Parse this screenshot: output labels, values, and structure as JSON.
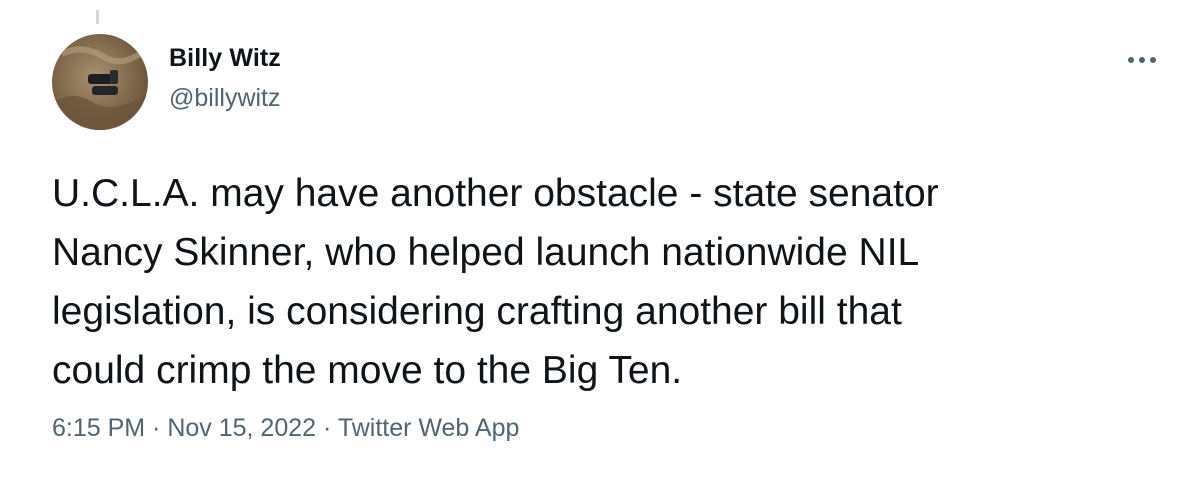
{
  "tweet": {
    "author": {
      "display_name": "Billy Witz",
      "handle": "@billywitz",
      "avatar": "profile-photo"
    },
    "more_icon": "more-horizontal-icon",
    "text": "U.C.L.A. may have another obstacle - state senator\nNancy Skinner, who helped launch nationwide NIL\nlegislation, is considering crafting another bill that\ncould crimp the move to the Big Ten.",
    "meta": {
      "time": "6:15 PM",
      "separator": " · ",
      "date": "Nov 15, 2022",
      "source": "Twitter Web App"
    }
  },
  "colors": {
    "text_primary": "#0f1419",
    "text_secondary": "#536471",
    "background": "#ffffff"
  }
}
